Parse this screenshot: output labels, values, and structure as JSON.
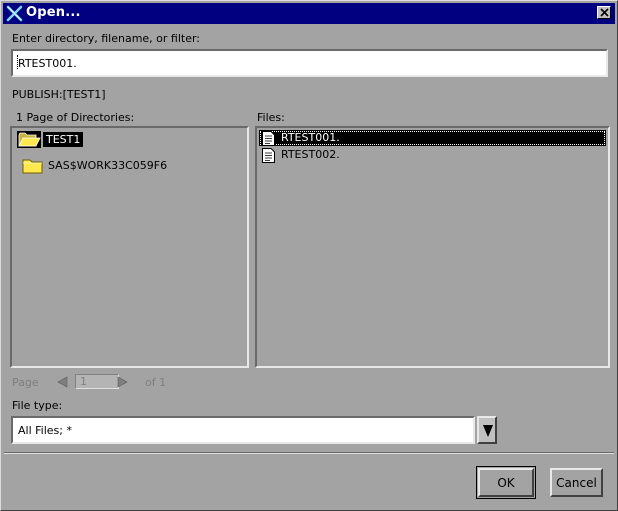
{
  "window": {
    "title": "Open..."
  },
  "path_prompt": {
    "label": "Enter directory, filename, or filter:",
    "value": "RTEST001."
  },
  "current_location": "PUBLISH:[TEST1]",
  "directories": {
    "header": "1 Page of Directories:",
    "items": [
      {
        "name": "TEST1",
        "selected": true,
        "open": true
      },
      {
        "name": "SAS$WORK33C059F6",
        "selected": false,
        "open": false
      }
    ]
  },
  "files": {
    "header": "Files:",
    "items": [
      {
        "name": "RTEST001.",
        "selected": true
      },
      {
        "name": "RTEST002.",
        "selected": false
      }
    ]
  },
  "pager": {
    "label": "Page",
    "page": "1",
    "of_label": "of 1"
  },
  "file_type": {
    "label": "File type:",
    "value": "All Files; *"
  },
  "buttons": {
    "ok": "OK",
    "cancel": "Cancel"
  },
  "colors": {
    "titlebar": "#000080",
    "background": "#a3a3a3",
    "folder": "#ffe94f",
    "selection": "#000000"
  },
  "icons": {
    "app": "x-logo-icon",
    "close": "close-icon",
    "folder_open": "folder-open-icon",
    "folder": "folder-icon",
    "file": "document-icon",
    "prev": "triangle-left-icon",
    "next": "triangle-right-icon",
    "dropdown": "triangle-down-icon"
  }
}
